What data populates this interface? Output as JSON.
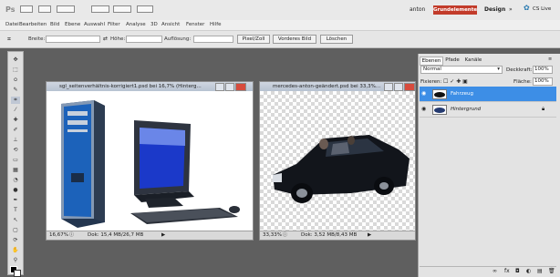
{
  "app": {
    "logo": "Ps",
    "user": "anton",
    "workspaces": [
      "Grundelemente",
      "Design",
      "»"
    ],
    "cs_live": "CS Live"
  },
  "menu": [
    "Datei",
    "Bearbeiten",
    "Bild",
    "Ebene",
    "Auswahl",
    "Filter",
    "Analyse",
    "3D",
    "Ansicht",
    "Fenster",
    "Hilfe"
  ],
  "options": {
    "breite_label": "Breite:",
    "hoehe_label": "Höhe:",
    "aufloesung_label": "Auflösung:",
    "unit": "Pixel/Zoll",
    "vorderes_bild": "Vorderes Bild",
    "loeschen": "Löschen"
  },
  "documents": [
    {
      "title": "sgl_seitenverhältnis-korrigiert1.psd bei 16,7% (Hinterg...",
      "zoom": "16,67%",
      "status": "Dok: 15,4 MB/26,7 MB"
    },
    {
      "title": "mercedes-anton-geändert.psd bei 33,3%...",
      "zoom": "33,33%",
      "status": "Dok: 3,52 MB/8,43 MB"
    }
  ],
  "panel": {
    "tabs": [
      "Ebenen",
      "Pfade",
      "Kanäle"
    ],
    "blend_mode": "Normal",
    "opacity_label": "Deckkraft:",
    "opacity_value": "100%",
    "lock_label": "Fixieren:",
    "fill_label": "Fläche:",
    "fill_value": "100%",
    "layers": [
      {
        "name": "Fahrzeug",
        "selected": true
      },
      {
        "name": "Hintergrund",
        "selected": false
      }
    ]
  },
  "colors": {
    "accent": "#c23b2a",
    "selection": "#3d8ee6"
  }
}
